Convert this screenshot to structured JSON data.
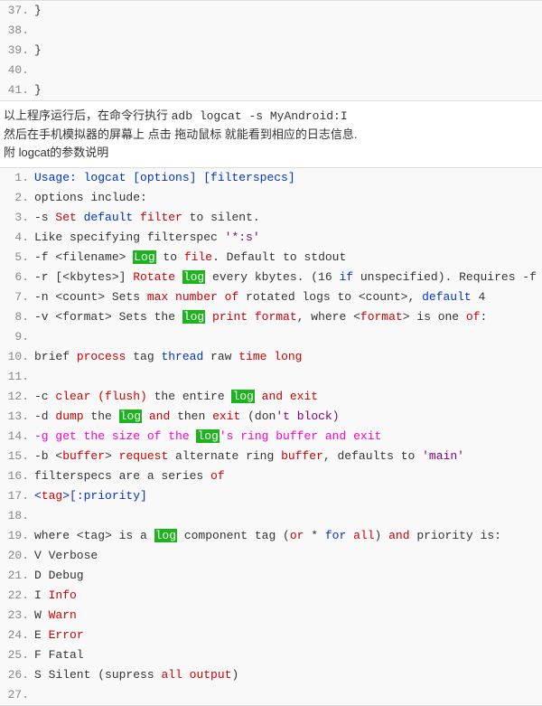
{
  "top_code": {
    "start": 37,
    "raw": [
      "}",
      "",
      "}",
      "",
      "}"
    ]
  },
  "desc": {
    "l1a": "以上程序运行后，在命令行执行  ",
    "l1b": "adb logcat -s MyAndroid:I",
    "l2": "然后在手机模拟器的屏幕上 点击 拖动鼠标 就能看到相应的日志信息.",
    "l3": "附 logcat的参数说明"
  },
  "main": [
    {
      "n": 1,
      "segs": [
        [
          "Usage: logcat [options] [filterspecs]",
          "t-blue"
        ]
      ]
    },
    {
      "n": 2,
      "segs": [
        [
          "options include:",
          ""
        ]
      ]
    },
    {
      "n": 3,
      "segs": [
        [
          "-s ",
          ""
        ],
        [
          "Set ",
          "t-red"
        ],
        [
          "default ",
          "t-blue"
        ],
        [
          "filter",
          "t-red"
        ],
        [
          " to silent.",
          ""
        ]
      ]
    },
    {
      "n": 4,
      "segs": [
        [
          "Like specifying filterspec ",
          ""
        ],
        [
          "'*:s'",
          "t-purple"
        ]
      ]
    },
    {
      "n": 5,
      "segs": [
        [
          "-f <filename> ",
          ""
        ],
        [
          "Log",
          "t-lbl"
        ],
        [
          " to ",
          ""
        ],
        [
          "file",
          "t-red"
        ],
        [
          ". Default to stdout",
          ""
        ]
      ]
    },
    {
      "n": 6,
      "segs": [
        [
          "-r [<kbytes>] ",
          ""
        ],
        [
          "Rotate ",
          "t-red"
        ],
        [
          "log",
          "t-lbl"
        ],
        [
          " every kbytes. (16 ",
          ""
        ],
        [
          "if",
          "t-blue"
        ],
        [
          " unspecified). Requires -f",
          ""
        ]
      ]
    },
    {
      "n": 7,
      "segs": [
        [
          "-n <count> Sets ",
          ""
        ],
        [
          "max number of",
          "t-red"
        ],
        [
          " rotated logs to <count>, ",
          ""
        ],
        [
          "default",
          "t-blue"
        ],
        [
          " 4",
          ""
        ]
      ]
    },
    {
      "n": 8,
      "segs": [
        [
          "-v <format> Sets the ",
          ""
        ],
        [
          "log",
          "t-lbl"
        ],
        [
          " ",
          ""
        ],
        [
          "print format",
          "t-red"
        ],
        [
          ", where <",
          ""
        ],
        [
          "format",
          "t-red"
        ],
        [
          "> is one ",
          ""
        ],
        [
          "of",
          "t-red"
        ],
        [
          ":",
          ""
        ]
      ]
    },
    {
      "n": 9,
      "segs": [
        [
          "",
          ""
        ]
      ]
    },
    {
      "n": 10,
      "segs": [
        [
          "brief ",
          ""
        ],
        [
          "process",
          "t-red"
        ],
        [
          " tag ",
          ""
        ],
        [
          "thread",
          "t-blue"
        ],
        [
          " raw ",
          ""
        ],
        [
          "time long",
          "t-red"
        ]
      ]
    },
    {
      "n": 11,
      "segs": [
        [
          "",
          ""
        ]
      ]
    },
    {
      "n": 12,
      "segs": [
        [
          "-c ",
          ""
        ],
        [
          "clear (flush)",
          "t-red"
        ],
        [
          " the entire ",
          ""
        ],
        [
          "log",
          "t-lbl"
        ],
        [
          " ",
          ""
        ],
        [
          "and exit",
          "t-red"
        ]
      ]
    },
    {
      "n": 13,
      "segs": [
        [
          "-d ",
          ""
        ],
        [
          "dump",
          "t-red"
        ],
        [
          " the ",
          ""
        ],
        [
          "log",
          "t-lbl"
        ],
        [
          " ",
          ""
        ],
        [
          "and",
          "t-red"
        ],
        [
          " then ",
          ""
        ],
        [
          "exit",
          "t-red"
        ],
        [
          " (don",
          ""
        ],
        [
          "'t block)",
          "t-purple"
        ]
      ]
    },
    {
      "n": 14,
      "cls": "line14",
      "segs": [
        [
          "-g get the size of the ",
          ""
        ],
        [
          "log",
          "t-lbl"
        ],
        [
          "'s ring buffer and exit",
          ""
        ]
      ]
    },
    {
      "n": 15,
      "segs": [
        [
          "-b <",
          ""
        ],
        [
          "buffer",
          "t-red"
        ],
        [
          "> ",
          ""
        ],
        [
          "request",
          "t-red"
        ],
        [
          " alternate ring ",
          ""
        ],
        [
          "buffer",
          "t-red"
        ],
        [
          ", defaults to ",
          ""
        ],
        [
          "'main'",
          "t-purple"
        ]
      ]
    },
    {
      "n": 16,
      "segs": [
        [
          "filterspecs are a series ",
          ""
        ],
        [
          "of",
          "t-red"
        ]
      ]
    },
    {
      "n": 17,
      "segs": [
        [
          "<",
          "t-blue"
        ],
        [
          "tag",
          "t-red"
        ],
        [
          ">[:priority]",
          "t-blue"
        ]
      ]
    },
    {
      "n": 18,
      "segs": [
        [
          "",
          ""
        ]
      ]
    },
    {
      "n": 19,
      "segs": [
        [
          "where <tag> is a ",
          ""
        ],
        [
          "log",
          "t-lbl"
        ],
        [
          " component tag (",
          ""
        ],
        [
          "or",
          "t-red"
        ],
        [
          " * ",
          ""
        ],
        [
          "for",
          "t-blue"
        ],
        [
          " ",
          ""
        ],
        [
          "all",
          "t-red"
        ],
        [
          ") ",
          ""
        ],
        [
          "and",
          "t-red"
        ],
        [
          " priority is:",
          ""
        ]
      ]
    },
    {
      "n": 20,
      "segs": [
        [
          "V Verbose",
          ""
        ]
      ]
    },
    {
      "n": 21,
      "segs": [
        [
          "D Debug",
          ""
        ]
      ]
    },
    {
      "n": 22,
      "segs": [
        [
          "I ",
          ""
        ],
        [
          "Info",
          "t-red"
        ]
      ]
    },
    {
      "n": 23,
      "segs": [
        [
          "W ",
          ""
        ],
        [
          "Warn",
          "t-red"
        ]
      ]
    },
    {
      "n": 24,
      "segs": [
        [
          "E ",
          ""
        ],
        [
          "Error",
          "t-red"
        ]
      ]
    },
    {
      "n": 25,
      "segs": [
        [
          "F Fatal",
          ""
        ]
      ]
    },
    {
      "n": 26,
      "segs": [
        [
          "S Silent (supress ",
          ""
        ],
        [
          "all output",
          "t-red"
        ],
        [
          ")",
          ""
        ]
      ]
    },
    {
      "n": 27,
      "segs": [
        [
          "",
          ""
        ]
      ]
    }
  ]
}
